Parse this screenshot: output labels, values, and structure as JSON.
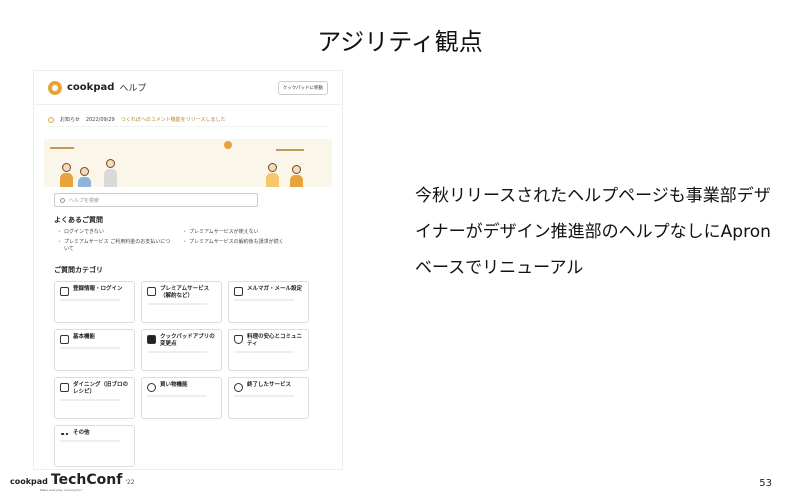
{
  "slide": {
    "title": "アジリティ観点",
    "body": "今秋リリースされたヘルプページも事業部デザイナーがデザイン推進部のヘルプなしにApronベースでリニューアル",
    "page_number": "53"
  },
  "footer": {
    "brand": "cookpad",
    "event": "TechConf",
    "year": "'22",
    "tagline": "Make everyday cooking fun!"
  },
  "screenshot": {
    "logo_text": "cookpad",
    "help_label": "ヘルプ",
    "back_button": "クックパッドに移動",
    "notice": {
      "label": "お知らせ",
      "date": "2022/09/29",
      "text": "つくれぽへのコメント機能をリリースしました"
    },
    "search_placeholder": "ヘルプを検索",
    "faq_title": "よくあるご質問",
    "faq_items": [
      "ログインできない",
      "プレミアムサービスが使えない",
      "プレミアムサービス ご利用料金のお支払いについて",
      "プレミアムサービスの解約後も請求が続く"
    ],
    "categories_title": "ご質問カテゴリ",
    "categories": [
      {
        "name": "登録情報・ログイン",
        "icon": "user-icon"
      },
      {
        "name": "プレミアムサービス（解約など）",
        "icon": "bookmark-icon"
      },
      {
        "name": "メルマガ・メール設定",
        "icon": "mail-icon"
      },
      {
        "name": "基本機能",
        "icon": "book-icon"
      },
      {
        "name": "クックパッドアプリの変更点",
        "icon": "new-badge-icon"
      },
      {
        "name": "料理の安心とコミュニティ",
        "icon": "shield-icon"
      },
      {
        "name": "ダイニング（旧ブロのレシピ）",
        "icon": "open-book-icon"
      },
      {
        "name": "買い物機能",
        "icon": "carrot-icon"
      },
      {
        "name": "終了したサービス",
        "icon": "history-icon"
      },
      {
        "name": "その他",
        "icon": "dots-icon"
      }
    ],
    "colors": {
      "accent": "#e8a33a"
    }
  }
}
